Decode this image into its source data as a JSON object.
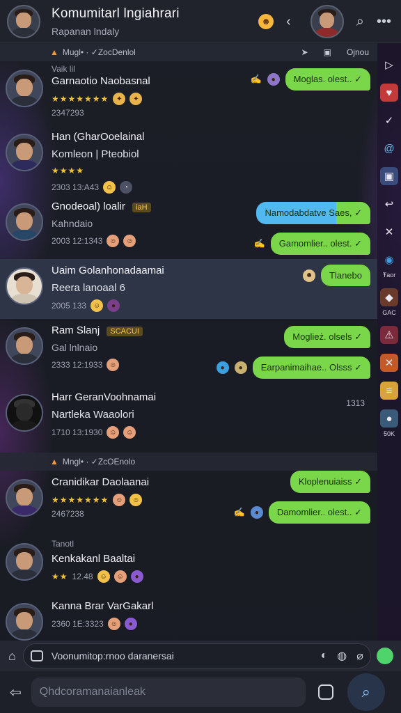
{
  "header": {
    "title": "Komumitarl lngiahrari",
    "subtitle": "Rapanan lndaly"
  },
  "strip_top": {
    "label": "Mugl• · ✓ZocDenlol",
    "right_label": "Ojnou"
  },
  "strip_mid": {
    "label": "Mngl• · ✓ZcOEnolo"
  },
  "chats": [
    {
      "name": "Garnaotio Naobasnal",
      "preview": "",
      "meta_top": "Vaik lil",
      "meta": "2347293",
      "stars": "★★★★★★★",
      "bubbles": [
        "Moglas. olest.. ✓"
      ]
    },
    {
      "name": "Han (GharOoelainal",
      "preview": "Komleon | Pteobiol",
      "stars": "★★★★",
      "meta": "2303 13:A43",
      "bubbles": []
    },
    {
      "name": "Gnodeoal) loalir",
      "tag": "iaH",
      "preview": "Kahndaio",
      "meta": "2003 12:1343",
      "bubbles": [
        "Namodabdatve  Saes, ✓",
        "Gamomlier.. olest. ✓"
      ]
    },
    {
      "name": "Uaim Golanhonadaamai",
      "preview": "Reera lanoaal 6",
      "meta": "2005 133",
      "bubbles": [
        "Tlanebo"
      ]
    },
    {
      "name": "Ram Slanj",
      "tag": "SCACUI",
      "preview": "Gal lnlnaio",
      "meta": "2333 12:1933",
      "bubbles": [
        "Moglież. olsels ✓",
        "Earpanimaihae.. Olsss ✓"
      ]
    },
    {
      "name": "Harr GeranVoohnamai",
      "preview": "Nartleka Waaolori",
      "meta": "1710 13:1930",
      "time": "1313",
      "bubbles": []
    },
    {
      "name": "Cranidikar Daolaanai",
      "preview": "",
      "meta": "2467238",
      "stars": "★★★★★★★",
      "bubbles": [
        "Kloplenuiaiss ✓",
        "Damomlier.. olest.. ✓"
      ]
    },
    {
      "name": "Kenkakanl Baaltai",
      "meta_top": "Tanotl",
      "preview": "",
      "meta": "12.48",
      "stars": "★★",
      "bubbles": []
    },
    {
      "name": "Kanna Brar VarGakarl",
      "preview": "",
      "meta": "2360 1E:3323",
      "bubbles": []
    }
  ],
  "rail": {
    "labels": [
      "Ŧaor",
      "GAC",
      "50K"
    ]
  },
  "composer": {
    "text": "Voonumitop:rnoo daranersai"
  },
  "bottom": {
    "placeholder": "Qhdcoramanaianleak"
  },
  "colors": {
    "bubble_green": "#7bd74a",
    "bubble_blue": "#52b8f0",
    "highlight_row": "#2e3547",
    "accent_star": "#f0c232"
  }
}
